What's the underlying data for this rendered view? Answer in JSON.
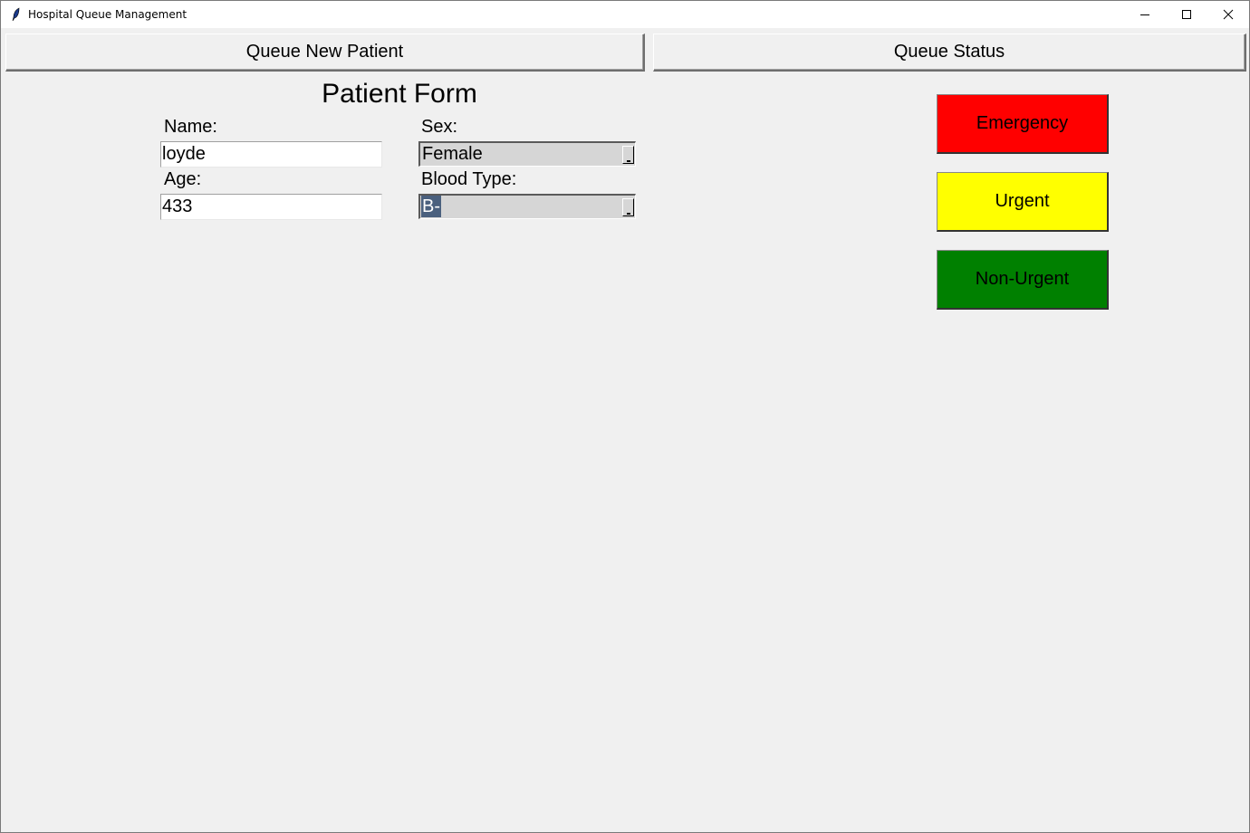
{
  "window": {
    "title": "Hospital Queue Management"
  },
  "nav": {
    "queue_new_patient_label": "Queue New Patient",
    "queue_status_label": "Queue Status"
  },
  "form": {
    "title": "Patient Form",
    "name_label": "Name:",
    "name_value": "loyde",
    "age_label": "Age:",
    "age_value": "433",
    "sex_label": "Sex:",
    "sex_value": "Female",
    "blood_type_label": "Blood Type:",
    "blood_type_value": "B-"
  },
  "priority": {
    "emergency_label": "Emergency",
    "urgent_label": "Urgent",
    "non_urgent_label": "Non-Urgent",
    "emergency_color": "#ff0000",
    "urgent_color": "#ffff00",
    "non_urgent_color": "#008000"
  },
  "icons": {
    "app": "feather-icon",
    "minimize": "minimize-icon",
    "maximize": "maximize-icon",
    "close": "close-icon",
    "dropdown": "chevron-down-icon"
  }
}
